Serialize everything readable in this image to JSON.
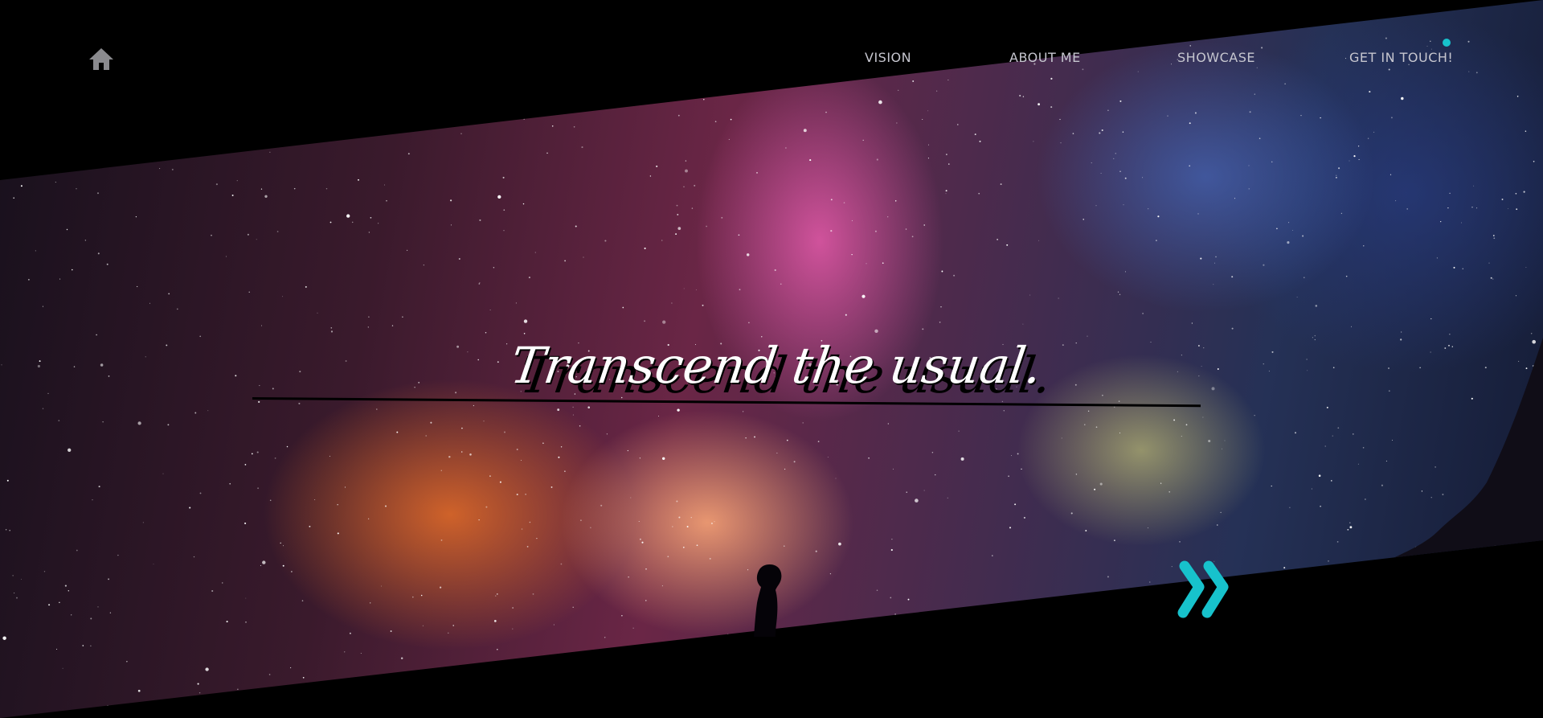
{
  "nav": {
    "home_icon": "home-icon",
    "links": [
      {
        "label": "VISION"
      },
      {
        "label": "ABOUT ME"
      },
      {
        "label": "SHOWCASE"
      },
      {
        "label": "GET IN TOUCH!"
      }
    ]
  },
  "hero": {
    "headline": "Transcend the usual.",
    "next_icon": "double-chevron-right-icon"
  },
  "colors": {
    "accent": "#17c2cc",
    "nav_text": "#c6c6cf",
    "background": "#000000",
    "headline": "#ffffff"
  }
}
